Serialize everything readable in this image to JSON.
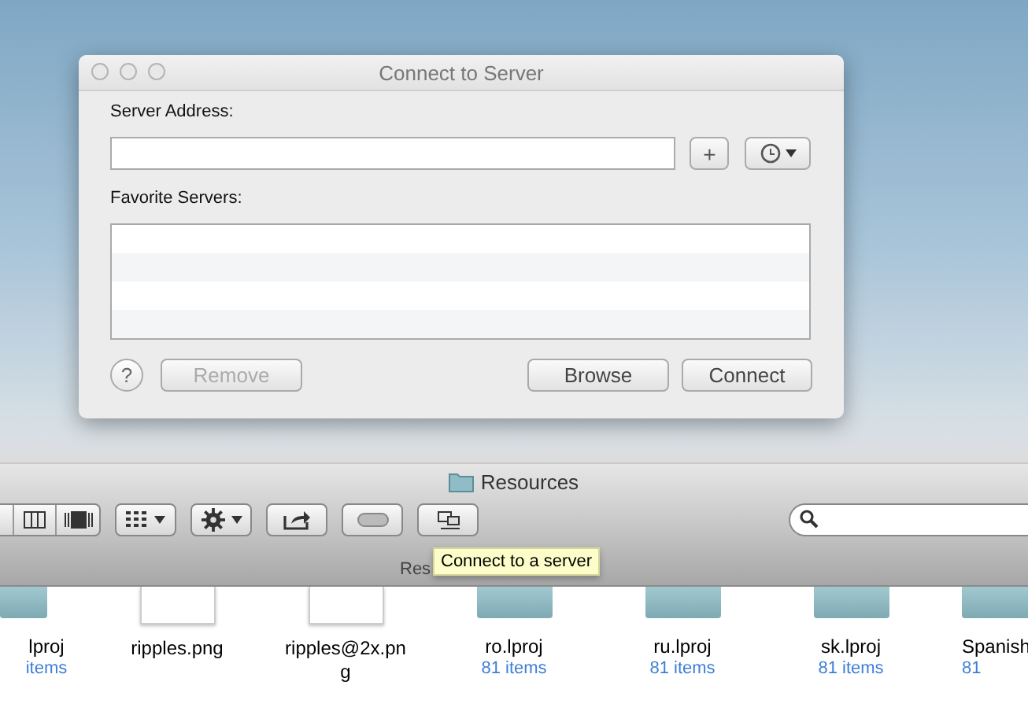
{
  "dialog": {
    "title": "Connect to Server",
    "address_label": "Server Address:",
    "add_button": "+",
    "favorites_label": "Favorite Servers:",
    "buttons": [
      {
        "kind": "help",
        "label": "?",
        "disabled": false
      },
      {
        "kind": "push",
        "label": "Remove",
        "disabled": true
      },
      {
        "kind": "spacer"
      },
      {
        "kind": "push",
        "label": "Browse",
        "disabled": false
      },
      {
        "kind": "push",
        "label": "Connect",
        "disabled": false
      }
    ]
  },
  "finder": {
    "title": "Resources",
    "toolbar": [
      {
        "kind": "views"
      },
      {
        "kind": "arrange"
      },
      {
        "kind": "action"
      },
      {
        "kind": "share"
      },
      {
        "kind": "toggle"
      },
      {
        "kind": "connect"
      }
    ],
    "path": "Res",
    "tooltip": "Connect to a server",
    "files": [
      {
        "kind": "folder",
        "name": "lproj",
        "count": "items"
      },
      {
        "kind": "image",
        "name": "ripples.png"
      },
      {
        "kind": "image",
        "name": "ripples@2x.png"
      },
      {
        "kind": "folder",
        "name": "ro.lproj",
        "count": "81 items"
      },
      {
        "kind": "folder",
        "name": "ru.lproj",
        "count": "81 items"
      },
      {
        "kind": "folder",
        "name": "sk.lproj",
        "count": "81 items"
      },
      {
        "kind": "folder",
        "name": "Spanish",
        "count": "81"
      }
    ]
  }
}
